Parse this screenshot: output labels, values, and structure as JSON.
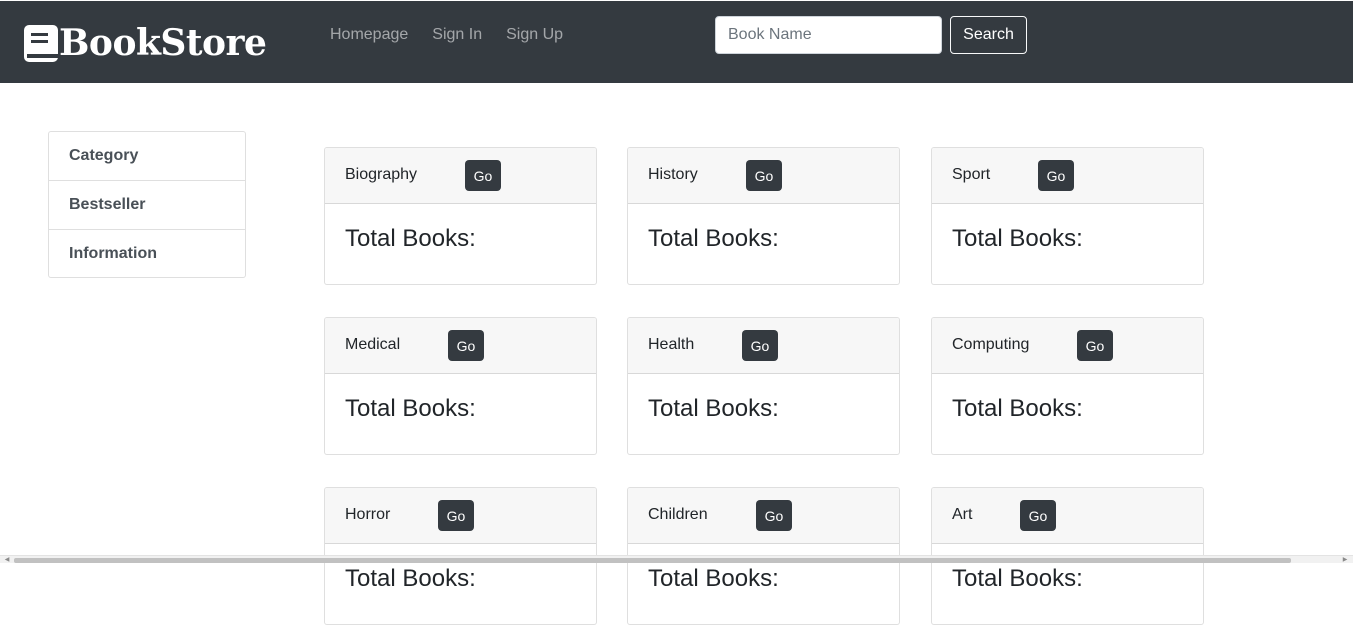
{
  "navbar": {
    "brand": "BookStore",
    "brand_icon": "book-icon",
    "links": [
      {
        "label": "Homepage"
      },
      {
        "label": "Sign In"
      },
      {
        "label": "Sign Up"
      }
    ],
    "search": {
      "placeholder": "Book Name",
      "value": "",
      "button_label": "Search"
    }
  },
  "sidebar": {
    "items": [
      {
        "label": "Category"
      },
      {
        "label": "Bestseller"
      },
      {
        "label": "Information"
      }
    ]
  },
  "categories": [
    {
      "name": "Biography",
      "button": "Go",
      "total_label": "Total Books:"
    },
    {
      "name": "History",
      "button": "Go",
      "total_label": "Total Books:"
    },
    {
      "name": "Sport",
      "button": "Go",
      "total_label": "Total Books:"
    },
    {
      "name": "Medical",
      "button": "Go",
      "total_label": "Total Books:"
    },
    {
      "name": "Health",
      "button": "Go",
      "total_label": "Total Books:"
    },
    {
      "name": "Computing",
      "button": "Go",
      "total_label": "Total Books:"
    },
    {
      "name": "Horror",
      "button": "Go",
      "total_label": "Total Books:"
    },
    {
      "name": "Children",
      "button": "Go",
      "total_label": "Total Books:"
    },
    {
      "name": "Art",
      "button": "Go",
      "total_label": "Total Books:"
    }
  ],
  "colors": {
    "navbar_bg": "#343a40",
    "button_dark": "#343a40",
    "card_header_bg": "#f7f7f7"
  }
}
